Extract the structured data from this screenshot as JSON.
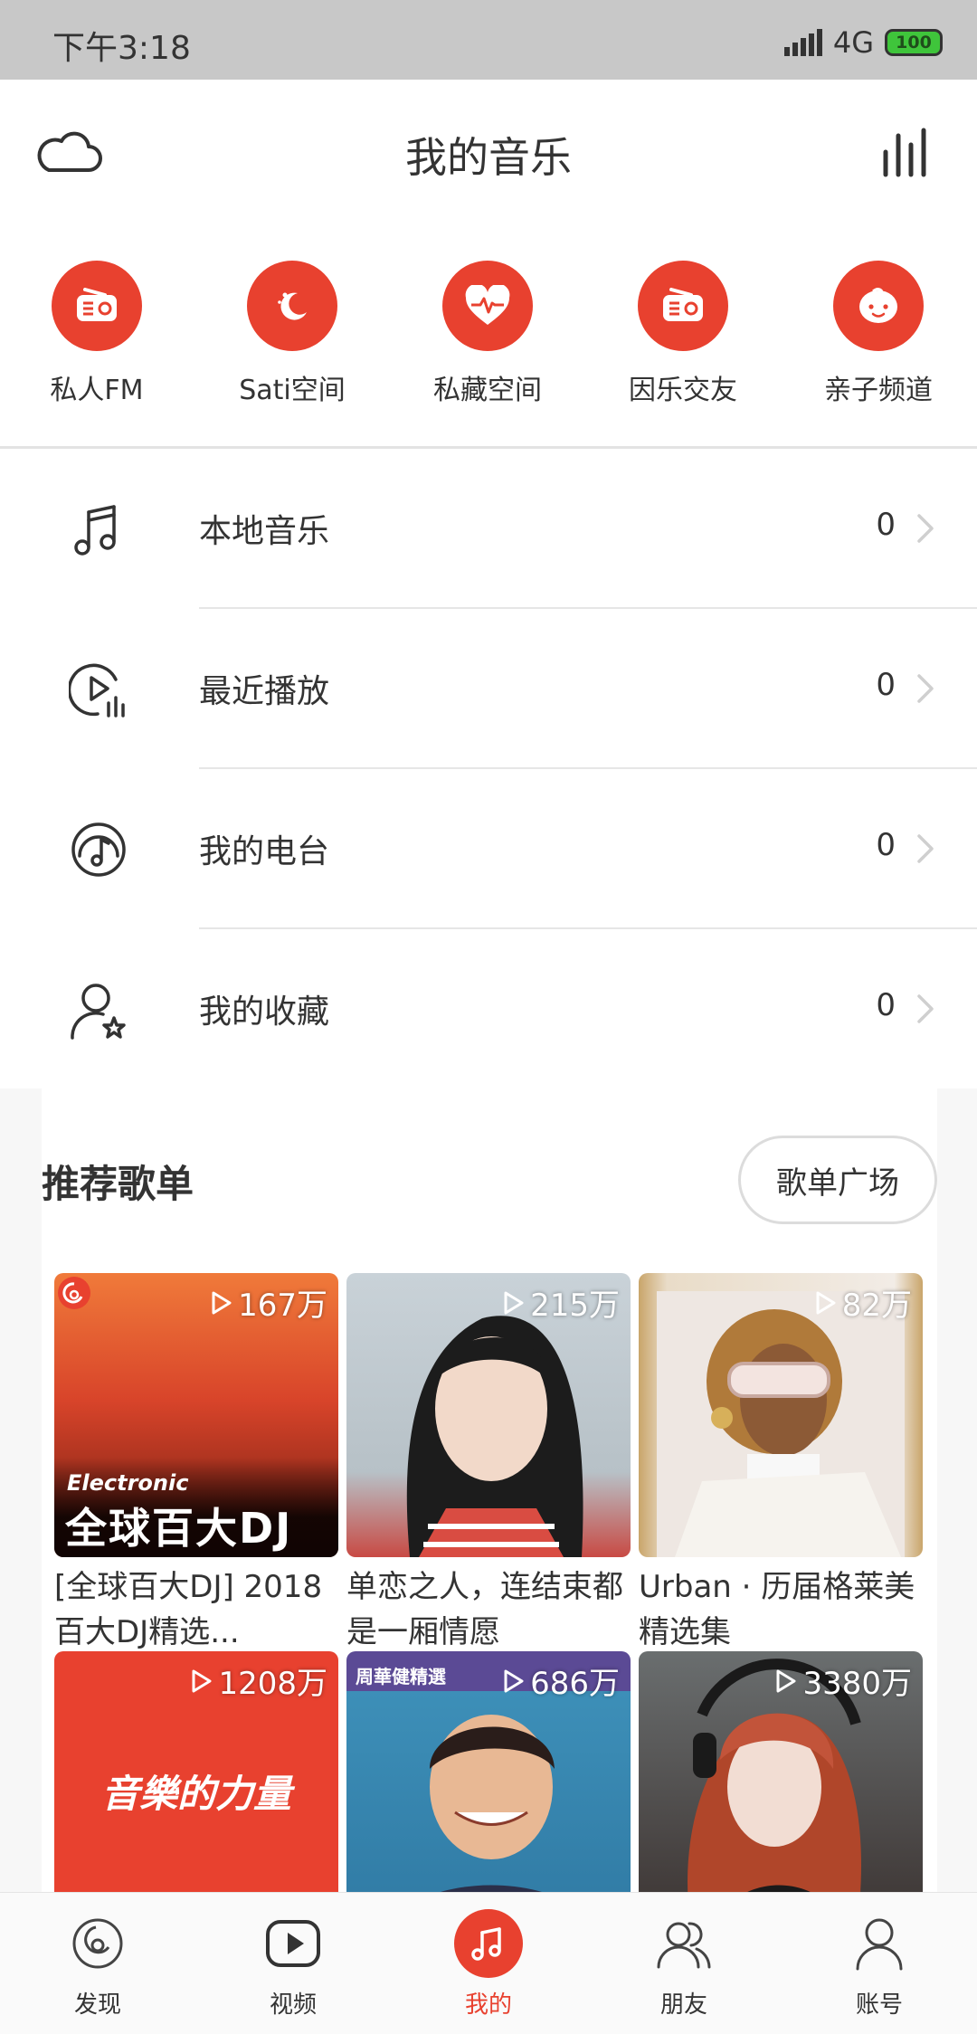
{
  "status_bar": {
    "time": "下午3:18",
    "network": "4G",
    "battery": "100"
  },
  "header": {
    "title": "我的音乐"
  },
  "shortcuts": [
    {
      "label": "私人FM",
      "icon": "radio-icon"
    },
    {
      "label": "Sati空间",
      "icon": "moon-icon"
    },
    {
      "label": "私藏空间",
      "icon": "heart-pulse-icon"
    },
    {
      "label": "因乐交友",
      "icon": "radio-icon"
    },
    {
      "label": "亲子频道",
      "icon": "baby-face-icon"
    }
  ],
  "list": [
    {
      "label": "本地音乐",
      "count": "0",
      "icon": "music-note-icon"
    },
    {
      "label": "最近播放",
      "count": "0",
      "icon": "recent-play-icon"
    },
    {
      "label": "我的电台",
      "count": "0",
      "icon": "radio-station-icon"
    },
    {
      "label": "我的收藏",
      "count": "0",
      "icon": "user-star-icon"
    }
  ],
  "recommend": {
    "title": "推荐歌单",
    "more_label": "歌单广场",
    "playlists": [
      {
        "plays": "167万",
        "title": "[全球百大DJ] 2018百大DJ精选...",
        "cover_text_small": "Electronic",
        "cover_text_big": "全球百大DJ",
        "color": "#c2391c"
      },
      {
        "plays": "215万",
        "title": "单恋之人，连结束都是一厢情愿",
        "color": "#9fb0b8"
      },
      {
        "plays": "82万",
        "title": "Urban · 历届格莱美精选集",
        "color": "#d8c2a0"
      },
      {
        "plays": "1208万",
        "title": "",
        "cover_text_big": "音樂的力量",
        "color": "#e8412f"
      },
      {
        "plays": "686万",
        "title": "",
        "cover_text_small": "周華健精選",
        "color": "#5b4a95"
      },
      {
        "plays": "3380万",
        "title": "",
        "color": "#4a3a34"
      }
    ]
  },
  "bottom_nav": [
    {
      "label": "发现",
      "icon": "discover-icon",
      "active": false
    },
    {
      "label": "视频",
      "icon": "video-icon",
      "active": false
    },
    {
      "label": "我的",
      "icon": "music-note-icon",
      "active": true
    },
    {
      "label": "朋友",
      "icon": "friends-icon",
      "active": false
    },
    {
      "label": "账号",
      "icon": "account-icon",
      "active": false
    }
  ],
  "colors": {
    "accent": "#e8412f",
    "status_bar": "#c8c8c8",
    "text": "#333333"
  }
}
